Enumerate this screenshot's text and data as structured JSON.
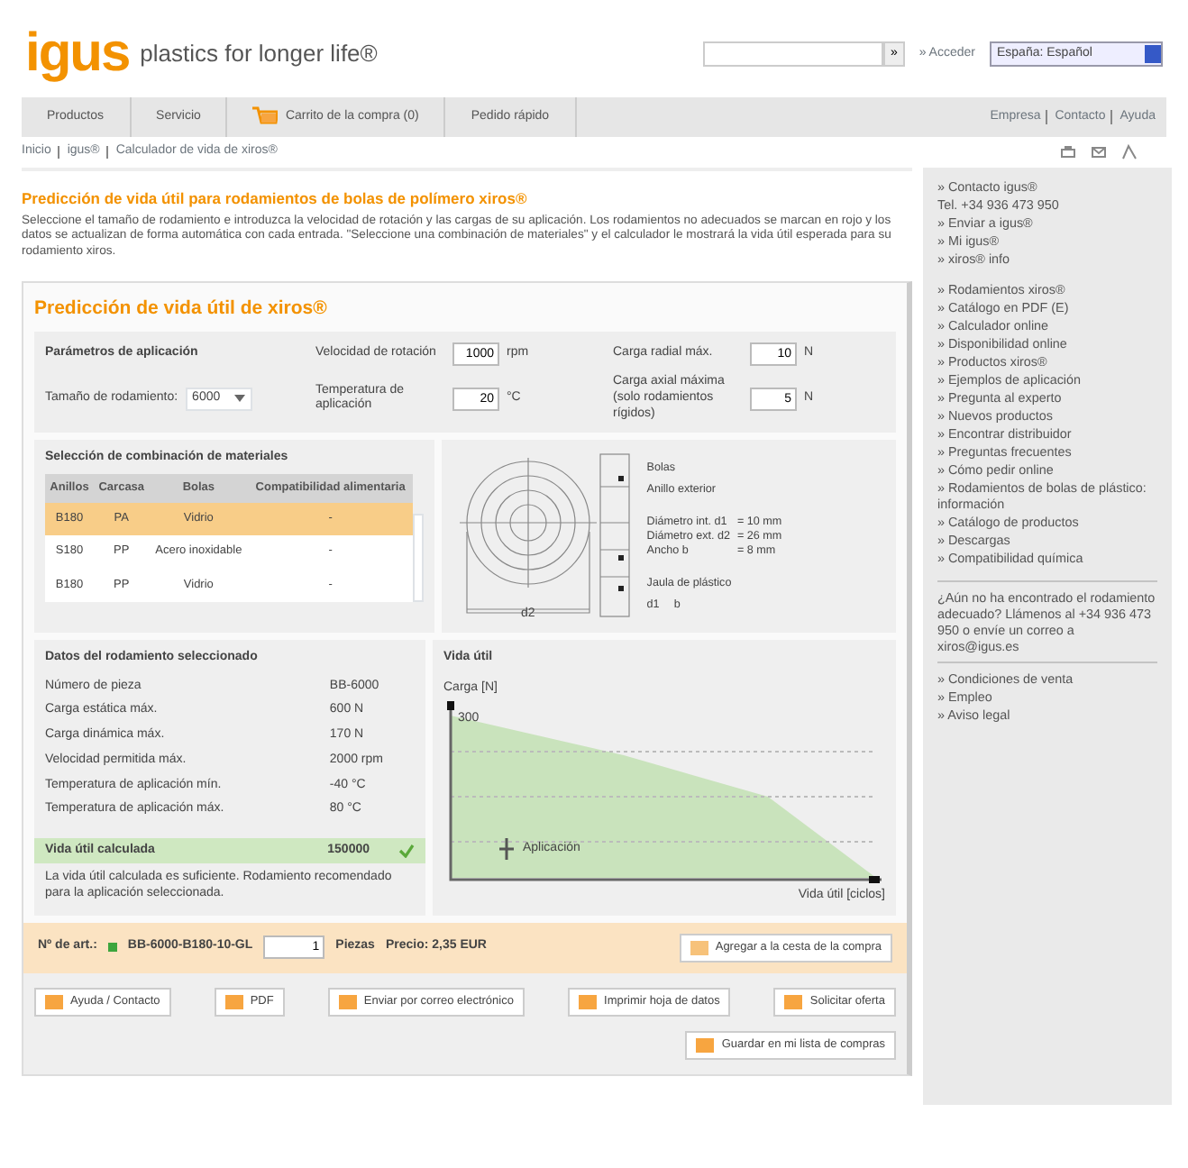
{
  "header": {
    "logo": "igus",
    "tagline": "plastics for longer life®",
    "search": {
      "button": "»"
    },
    "login": "» Acceder",
    "language": "España: Español"
  },
  "nav": {
    "items": [
      {
        "label": "Productos",
        "kind": "plain"
      },
      {
        "label": "Servicio",
        "kind": "plain"
      },
      {
        "label": "Carrito de la compra (0)",
        "kind": "cart"
      },
      {
        "label": "Pedido rápido",
        "kind": "plain"
      }
    ],
    "right": [
      "Empresa",
      "Contacto",
      "Ayuda"
    ]
  },
  "breadcrumb": [
    "Inicio",
    "igus®",
    "Calculador de vida de xiros®"
  ],
  "title": "Predicción de vida útil para rodamientos de bolas de polímero xiros®",
  "intro": "Seleccione el tamaño de rodamiento e introduzca la velocidad de rotación y las cargas de su aplicación. Los rodamientos no adecuados se marcan en rojo y los datos se actualizan de forma automática con cada entrada. \"Seleccione una combinación de materiales\" y el calculador le mostrará la vida útil esperada para su rodamiento xiros.",
  "calc": {
    "title": "Predicción de vida útil de xiros®",
    "params_title": "Parámetros de aplicación",
    "fields": [
      {
        "kind": "number",
        "label": "Velocidad de rotación",
        "value": "1000",
        "unit": "rpm"
      },
      {
        "kind": "number",
        "label": "Carga radial máx.",
        "value": "10",
        "unit": "N"
      },
      {
        "kind": "select",
        "label": "Tamaño de rodamiento:",
        "value": "6000"
      },
      {
        "kind": "number",
        "label": "Temperatura de aplicación",
        "value": "20",
        "unit": "°C"
      },
      {
        "kind": "number",
        "label": "Carga axial máxima (solo rodamientos rígidos)",
        "value": "5",
        "unit": "N"
      }
    ],
    "materials": {
      "title": "Selección de combinación de materiales",
      "columns": [
        "Anillos",
        "Carcasa",
        "Bolas",
        "Compatibilidad alimentaria"
      ],
      "rows": [
        {
          "cells": [
            "B180",
            "PA",
            "Vidrio",
            "-"
          ],
          "selected": true
        },
        {
          "cells": [
            "S180",
            "PP",
            "Acero inoxidable",
            "-"
          ],
          "selected": false
        },
        {
          "cells": [
            "B180",
            "PP",
            "Vidrio",
            "-"
          ],
          "selected": false
        }
      ]
    },
    "drawing": {
      "labels": [
        "Bolas",
        "Anillo exterior"
      ],
      "specs": [
        [
          "Diámetro int. d1",
          "= 10 mm"
        ],
        [
          "Diámetro ext. d2",
          "= 26 mm"
        ],
        [
          "Ancho b",
          "= 8 mm"
        ]
      ],
      "bottom_label": "Jaula de plástico",
      "d_label": "d2",
      "b_label": "b",
      "d1_label": "d1"
    },
    "data": {
      "title": "Datos del rodamiento seleccionado",
      "rows": [
        [
          "Número de pieza",
          "BB-6000"
        ],
        [
          "Carga estática máx.",
          "600 N"
        ],
        [
          "Carga dinámica máx.",
          "170 N"
        ],
        [
          "Velocidad permitida máx.",
          "2000 rpm"
        ],
        [
          "Temperatura de aplicación mín.",
          "-40 °C"
        ],
        [
          "Temperatura de aplicación máx.",
          "80 °C"
        ]
      ]
    },
    "result": {
      "label": "Vida útil calculada",
      "value": "150000",
      "ok": true,
      "note": "La vida útil calculada es suficiente. Rodamiento recomendado para la aplicación seleccionada."
    },
    "chart": {
      "title": "Vida útil",
      "ylabel": "Carga [N]",
      "ytick": "300",
      "marker": "Aplicación",
      "xlabel": "Vida útil [ciclos]"
    }
  },
  "order": {
    "label": "Nº de art.:",
    "article": "BB-6000-B180-10-GL",
    "qty": "1",
    "unit": "Piezas",
    "price": "Precio: 2,35 EUR",
    "button": "Agregar a la cesta de la compra"
  },
  "actions": [
    {
      "label": "Ayuda / Contacto"
    },
    {
      "label": "PDF"
    },
    {
      "label": "Enviar por correo electrónico"
    },
    {
      "label": "Imprimir hoja de datos"
    },
    {
      "label": "Solicitar oferta"
    },
    {
      "label": "Guardar en mi lista de compras"
    }
  ],
  "sidebar": {
    "groups": [
      [
        "» Contacto igus®",
        "Tel. +34 936 473 950",
        "» Enviar a igus®",
        "» Mi igus®",
        "» xiros® info"
      ],
      [
        "» Rodamientos xiros®",
        "» Catálogo en PDF (E)",
        "» Calculador online",
        "» Disponibilidad online",
        "» Productos xiros®",
        "» Ejemplos de aplicación",
        "» Pregunta al experto",
        "» Nuevos productos",
        "» Encontrar distribuidor",
        "» Preguntas frecuentes",
        "» Cómo pedir online",
        "» Rodamientos de bolas de plástico: información",
        "» Catálogo de productos",
        "» Descargas",
        "» Compatibilidad química"
      ]
    ],
    "note": "¿Aún no ha encontrado el rodamiento adecuado? Llámenos al +34 936 473 950 o envíe un correo a xiros@igus.es",
    "bottom": [
      "» Condiciones de venta",
      "» Empleo",
      "» Aviso legal"
    ]
  }
}
